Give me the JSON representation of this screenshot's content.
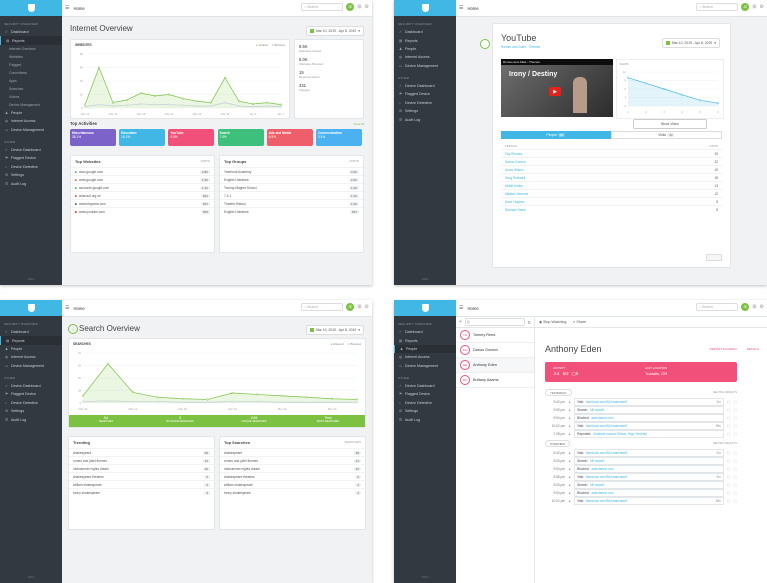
{
  "sidebar": {
    "security_label": "SECURITY OVERVIEW",
    "items": [
      "Dashboard",
      "Reports",
      "People",
      "Internet Access",
      "Device Management"
    ],
    "report_subitems": [
      "Internet Overview",
      "Websites",
      "Flagged",
      "Committees",
      "Apps",
      "Searches",
      "Videos",
      "Device Management"
    ],
    "other_label": "OTHER",
    "other_items": [
      "Device Dashboard",
      "Flagged Device",
      "Device Detective",
      "Settings",
      "Audit Log"
    ],
    "footer": "2019"
  },
  "topbar": {
    "home": "Home",
    "search_placeholder": "Search",
    "avatar": "JE"
  },
  "p1": {
    "title": "Internet Overview",
    "daterange": "Mar 10, 2019 - Apr 8, 2019",
    "chart_title": "WEBSITES",
    "legend": [
      "Visited",
      "Blocked"
    ],
    "stats": [
      {
        "value": "8.5K",
        "label": "Websites Visited"
      },
      {
        "value": "5.0K",
        "label": "Websites Blocked"
      },
      {
        "value": "15",
        "label": "Reported Alerts"
      },
      {
        "value": "331",
        "label": "Flagged"
      }
    ],
    "activities_title": "Top Activities",
    "view_all": "View All",
    "tiles": [
      {
        "title": "Miscellaneous",
        "value": "38.1%",
        "color": "#7b63c9"
      },
      {
        "title": "Education",
        "value": "15.1%",
        "color": "#40b7e4"
      },
      {
        "title": "YouTube",
        "value": "9.5%",
        "color": "#f0507a"
      },
      {
        "title": "Search",
        "value": "7.5%",
        "color": "#3cc07b"
      },
      {
        "title": "Ads and Media",
        "value": "6.9%",
        "color": "#ef5f6b"
      },
      {
        "title": "Communication",
        "value": "5.1%",
        "color": "#4bb1f0"
      }
    ],
    "top_websites_title": "Top Websites",
    "top_websites_col": "VISITS",
    "top_websites": [
      {
        "name": "docs.google.com",
        "count": "2.8K"
      },
      {
        "name": "www.google.com",
        "count": "1.9K"
      },
      {
        "name": "accounts.google.com",
        "count": "1.1K"
      },
      {
        "name": "www.aol.org.uk",
        "count": "661"
      },
      {
        "name": "www.bbgrams.com",
        "count": "567"
      },
      {
        "name": "www.youtube.com",
        "count": "555"
      }
    ],
    "top_groups_title": "Top Groups",
    "top_groups_col": "VISITS",
    "top_groups": [
      {
        "name": "Yearbook Academy",
        "count": "3.3K"
      },
      {
        "name": "English Literature",
        "count": "2.6K"
      },
      {
        "name": "Touring Magnet School",
        "count": "1.2K"
      },
      {
        "name": "7 & 1",
        "count": "1.1K"
      },
      {
        "name": "Theatre History",
        "count": "1.0K"
      },
      {
        "name": "English Literature",
        "count": "837"
      }
    ]
  },
  "p2": {
    "title": "YouTube",
    "subtitle": "Romeo and Juliet · Themes",
    "daterange": "Mar 10, 2019 - Apr 8, 2019",
    "video_title": "Romeo and Juliet - Themes",
    "video_caption": "Irony / Destiny",
    "views_label": "VIEWS",
    "block_btn": "Block Video",
    "tabs": [
      "People",
      "Visits"
    ],
    "col_person": "PERSON",
    "col_visits": "VISITS",
    "people": [
      {
        "name": "Fay Rhodes",
        "v": "29"
      },
      {
        "name": "Darius Gordon",
        "v": "22"
      },
      {
        "name": "Amos Wilson",
        "v": "19"
      },
      {
        "name": "Greg Rothwell",
        "v": "18"
      },
      {
        "name": "Mollie Kelley",
        "v": "13"
      },
      {
        "name": "Mirabel Jimenez",
        "v": "12"
      },
      {
        "name": "Dave Hughes",
        "v": "9"
      },
      {
        "name": "Rachael Hawk",
        "v": "8"
      }
    ]
  },
  "p3": {
    "title": "Search Overview",
    "daterange": "Mar 10, 2019 - Apr 8, 2019",
    "chart_title": "SEARCHES",
    "legend": [
      "Allowed",
      "Blocked"
    ],
    "stats": [
      {
        "value": "54",
        "label": "SEARCHES"
      },
      {
        "value": "3",
        "label": "BLOCKED SEARCHES"
      },
      {
        "value": "245",
        "label": "UNIQUE SEARCHES"
      },
      {
        "value": "Test",
        "label": "MOST SEARCHED"
      }
    ],
    "trending_title": "Trending",
    "trending": [
      {
        "name": "shakespeare",
        "c": "38"
      },
      {
        "name": "romeo and juliet themes",
        "c": "14"
      },
      {
        "name": "midsummer nights dream",
        "c": "10"
      },
      {
        "name": "shakespeare theaters",
        "c": "5"
      },
      {
        "name": "william shakespeare",
        "c": "4"
      },
      {
        "name": "funny shakespeare",
        "c": "3"
      }
    ],
    "top_searches_title": "Top Searches",
    "top_searches_col": "SEARCHES",
    "top_searches": [
      {
        "name": "shakespeare",
        "c": "38"
      },
      {
        "name": "romeo and juliet themes",
        "c": "14"
      },
      {
        "name": "midsummer nights dream",
        "c": "10"
      },
      {
        "name": "shakespeare theaters",
        "c": "5"
      },
      {
        "name": "william shakespeare",
        "c": "4"
      },
      {
        "name": "funny shakespeare",
        "c": "3"
      }
    ]
  },
  "p4": {
    "search_placeholder": "Q",
    "stop_watching": "Stop Watching",
    "share": "Share",
    "people": [
      {
        "initials": "TR",
        "name": "Tommy Reed"
      },
      {
        "initials": "DG",
        "name": "Darius Gordon"
      },
      {
        "initials": "AE",
        "name": "Anthony Eden"
      },
      {
        "initials": "BA",
        "name": "Brittany Adams"
      }
    ],
    "name": "Anthony Eden",
    "report_incident": "REPORT INCIDENT",
    "details": "DETAILS",
    "activity_label": "ACTIVITY",
    "activity_counts": [
      "4",
      "2",
      "5"
    ],
    "location_label": "LAST LOCATION",
    "location": "Tualatin, OR",
    "day1": "YESTERDAY",
    "day2": "OVERVIEW",
    "helpful": "HELPFUL RESULTS",
    "events": [
      {
        "time": "9:42 pm",
        "label": "Visit:",
        "value": "facebook.com/541maresstuff",
        "extra": "3m"
      },
      {
        "time": "9:53 pm",
        "label": "Search:",
        "value": "kill myself",
        "extra": ""
      },
      {
        "time": "9:54 pm",
        "label": "Blocked:",
        "value": "awlndance.com",
        "extra": ""
      },
      {
        "time": "10:02 pm",
        "label": "Visit:",
        "value": "facebook.com/541maresstuff",
        "extra": "58s"
      },
      {
        "time": "7:28 pm",
        "label": "Reported:",
        "value": "Violence toward Others, High Severity",
        "extra": ""
      }
    ],
    "events2": [
      {
        "time": "9:42 pm",
        "label": "Visit:",
        "value": "facebook.com/541maresstuff",
        "extra": "3m"
      },
      {
        "time": "9:53 pm",
        "label": "Search:",
        "value": "kill myself",
        "extra": ""
      },
      {
        "time": "9:54 pm",
        "label": "Blocked:",
        "value": "awlndance.com",
        "extra": ""
      },
      {
        "time": "9:58 pm",
        "label": "Visit:",
        "value": "facebook.com/541maresstuff",
        "extra": "3m"
      },
      {
        "time": "9:53 pm",
        "label": "Search:",
        "value": "kill myself",
        "extra": ""
      },
      {
        "time": "9:54 pm",
        "label": "Blocked:",
        "value": "awlndance.com",
        "extra": ""
      },
      {
        "time": "10:02 pm",
        "label": "Visit:",
        "value": "facebook.com/541maresstuff",
        "extra": "58s"
      }
    ]
  },
  "chart_data": [
    {
      "type": "line",
      "title": "WEBSITES",
      "series": [
        {
          "name": "Visited",
          "values": [
            5,
            60,
            8,
            12,
            22,
            18,
            20,
            14,
            10,
            8,
            45,
            10,
            6,
            8,
            5
          ]
        },
        {
          "name": "Blocked",
          "values": [
            2,
            5,
            3,
            4,
            6,
            5,
            5,
            4,
            3,
            3,
            8,
            3,
            2,
            3,
            2
          ]
        }
      ],
      "x": [
        "Mar 10",
        "Mar 12",
        "Mar 14",
        "Mar 16",
        "Mar 18",
        "Mar 20",
        "Mar 22",
        "Mar 24",
        "Mar 26",
        "Mar 28",
        "Mar 30",
        "Apr 1",
        "Apr 3",
        "Apr 5",
        "Apr 7"
      ],
      "ylim": [
        0,
        80
      ]
    },
    {
      "type": "line",
      "title": "SEARCHES",
      "series": [
        {
          "name": "Allowed",
          "values": [
            10,
            55,
            15,
            8,
            6,
            5,
            14,
            12,
            10,
            8,
            6,
            5
          ]
        },
        {
          "name": "Blocked",
          "values": [
            2,
            3,
            2,
            2,
            1,
            1,
            2,
            2,
            1,
            1,
            1,
            1
          ]
        }
      ],
      "x": [
        "Mar 10",
        "Mar 12",
        "Mar 14",
        "Mar 16",
        "Mar 18",
        "Mar 20",
        "Mar 22",
        "Mar 24",
        "Mar 26",
        "Mar 28",
        "Mar 30",
        "Apr 1"
      ],
      "ylim": [
        0,
        70
      ]
    },
    {
      "type": "line",
      "title": "VIEWS",
      "series": [
        {
          "name": "Views",
          "values": [
            10,
            8,
            6,
            4,
            2,
            1
          ]
        }
      ],
      "x": [
        "1",
        "2",
        "3",
        "4",
        "5",
        "6"
      ],
      "ylim": [
        0,
        12
      ]
    }
  ]
}
